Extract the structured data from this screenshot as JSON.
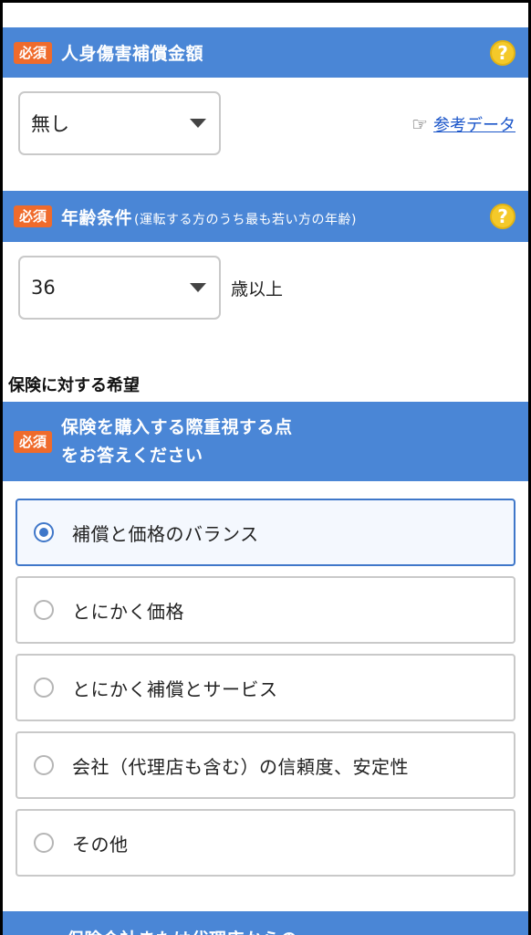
{
  "personal_injury": {
    "badge": "必須",
    "title": "人身傷害補償金額",
    "help_icon": "?",
    "select_value": "無し",
    "ref_icon": "☞",
    "ref_link": "参考データ"
  },
  "age_condition": {
    "badge": "必須",
    "title": "年齢条件",
    "subtitle": "(運転する方のうち最も若い方の年齢)",
    "help_icon": "?",
    "select_value": "36",
    "unit": "歳以上"
  },
  "insurance_hope": {
    "section_title": "保険に対する希望",
    "badge": "必須",
    "question_line1": "保険を購入する際重視する点",
    "question_line2": "をお答えください",
    "options": [
      {
        "label": "補償と価格のバランス",
        "selected": true
      },
      {
        "label": "とにかく価格",
        "selected": false
      },
      {
        "label": "とにかく補償とサービス",
        "selected": false
      },
      {
        "label": "会社（代理店も含む）の信頼度、安定性",
        "selected": false
      },
      {
        "label": "その他",
        "selected": false
      }
    ]
  },
  "next_section": {
    "title_partial": "保険会社または代理店からの"
  },
  "colors": {
    "accent_blue": "#4a86d6",
    "badge_orange": "#ef6b2c",
    "help_yellow": "#f4c92a",
    "link_blue": "#1a55c9"
  }
}
